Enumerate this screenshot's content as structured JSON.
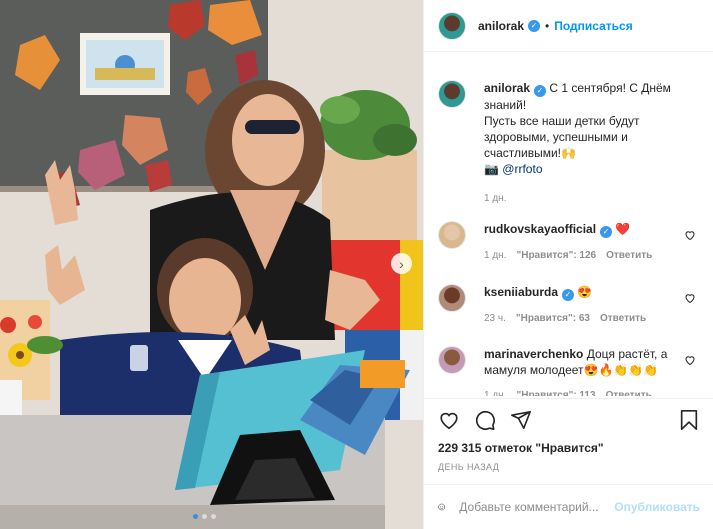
{
  "post": {
    "username": "anilorak",
    "follow_label": "Подписаться",
    "caption_lines": "С 1 сентября! С Днём\nзнаний!\nПусть все наши детки будут\nздоровыми, успешными и\nсчастливыми!🙌",
    "caption_credit_icon": "📷",
    "caption_mention": "@rrfoto",
    "caption_time": "1 дн.",
    "likes_text": "229 315 отметок \"Нравится\"",
    "date_text": "ДЕНЬ НАЗАД"
  },
  "comments": [
    {
      "username": "rudkovskayaofficial",
      "text": "❤️",
      "time": "1 дн.",
      "likes": "\"Нравится\": 126",
      "reply": "Ответить"
    },
    {
      "username": "kseniiaburda",
      "text": "😍",
      "time": "23 ч.",
      "likes": "\"Нравится\": 63",
      "reply": "Ответить"
    },
    {
      "username": "marinaverchenko",
      "text": "Доця растёт, а мамуля молодеет😍🔥👏👏👏",
      "time": "1 дн.",
      "likes": "\"Нравится\": 113",
      "reply": "Ответить"
    }
  ],
  "composer": {
    "placeholder": "Добавьте комментарий...",
    "publish_label": "Опубликовать"
  },
  "carousel": {
    "count": 3,
    "active_index": 0
  },
  "icons": {
    "like": "heart-icon",
    "comment": "comment-icon",
    "share": "share-icon",
    "save": "bookmark-icon",
    "emoji": "emoji-icon",
    "next": "chevron-right-icon"
  },
  "colors": {
    "link_blue": "#0095f6",
    "verified_blue": "#3897f0",
    "muted_gray": "#8e8e8e",
    "publish_disabled": "#b2dffc"
  }
}
